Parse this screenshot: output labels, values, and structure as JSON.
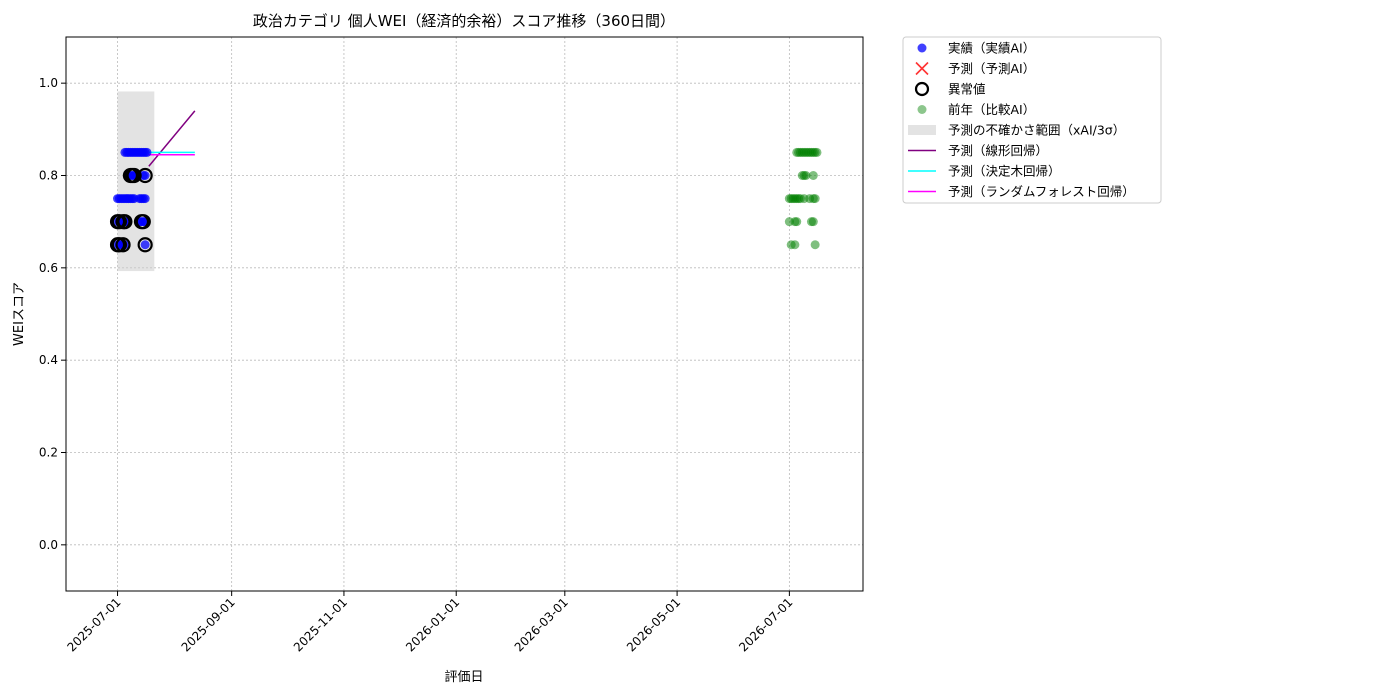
{
  "chart_data": {
    "type": "scatter",
    "title": "政治カテゴリ 個人WEI（経済的余裕）スコア推移（360日間）",
    "xlabel": "評価日",
    "ylabel": "WEIスコア",
    "xlim": [
      "2025-06-03",
      "2026-08-10"
    ],
    "ylim": [
      -0.1,
      1.1
    ],
    "x_ticks": [
      "2025-07-01",
      "2025-09-01",
      "2025-11-01",
      "2026-01-01",
      "2026-03-01",
      "2026-05-01",
      "2026-07-01"
    ],
    "y_ticks": [
      0.0,
      0.2,
      0.4,
      0.6,
      0.8,
      1.0
    ],
    "y_tick_labels": [
      "0.0",
      "0.2",
      "0.4",
      "0.6",
      "0.8",
      "1.0"
    ],
    "grid": true,
    "legend_position": "outside-right",
    "legend": [
      {
        "label": "実績（実績AI）",
        "marker": "dot",
        "color": "#0000ff"
      },
      {
        "label": "予測（予測AI）",
        "marker": "x",
        "color": "#ff0000"
      },
      {
        "label": "異常値",
        "marker": "ring",
        "color": "#000000"
      },
      {
        "label": "前年（比較AI）",
        "marker": "dot",
        "color": "#008000"
      },
      {
        "label": "予測の不確かさ範囲（xAI/3σ）",
        "marker": "patch",
        "color": "#cccccc"
      },
      {
        "label": "予測（線形回帰）",
        "marker": "line",
        "color": "#800080"
      },
      {
        "label": "予測（決定木回帰）",
        "marker": "line",
        "color": "#00ffff"
      },
      {
        "label": "予測（ランダムフォレスト回帰）",
        "marker": "line",
        "color": "#ff00ff"
      }
    ],
    "uncertainty_band": {
      "x": [
        "2025-07-01",
        "2025-07-21"
      ],
      "y": [
        0.593,
        0.982
      ]
    },
    "series": [
      {
        "name": "実績（実績AI）",
        "color": "#0000ff",
        "points": [
          [
            "2025-07-01",
            0.65
          ],
          [
            "2025-07-01",
            0.7
          ],
          [
            "2025-07-01",
            0.75
          ],
          [
            "2025-07-02",
            0.65
          ],
          [
            "2025-07-02",
            0.7
          ],
          [
            "2025-07-02",
            0.75
          ],
          [
            "2025-07-03",
            0.65
          ],
          [
            "2025-07-03",
            0.7
          ],
          [
            "2025-07-03",
            0.75
          ],
          [
            "2025-07-04",
            0.65
          ],
          [
            "2025-07-04",
            0.7
          ],
          [
            "2025-07-04",
            0.75
          ],
          [
            "2025-07-05",
            0.65
          ],
          [
            "2025-07-05",
            0.7
          ],
          [
            "2025-07-05",
            0.75
          ],
          [
            "2025-07-05",
            0.85
          ],
          [
            "2025-07-06",
            0.7
          ],
          [
            "2025-07-06",
            0.75
          ],
          [
            "2025-07-06",
            0.85
          ],
          [
            "2025-07-07",
            0.75
          ],
          [
            "2025-07-07",
            0.8
          ],
          [
            "2025-07-07",
            0.85
          ],
          [
            "2025-07-08",
            0.75
          ],
          [
            "2025-07-08",
            0.8
          ],
          [
            "2025-07-08",
            0.85
          ],
          [
            "2025-07-09",
            0.75
          ],
          [
            "2025-07-09",
            0.8
          ],
          [
            "2025-07-09",
            0.85
          ],
          [
            "2025-07-10",
            0.75
          ],
          [
            "2025-07-10",
            0.8
          ],
          [
            "2025-07-10",
            0.85
          ],
          [
            "2025-07-11",
            0.8
          ],
          [
            "2025-07-11",
            0.85
          ],
          [
            "2025-07-12",
            0.85
          ],
          [
            "2025-07-13",
            0.7
          ],
          [
            "2025-07-13",
            0.75
          ],
          [
            "2025-07-13",
            0.85
          ],
          [
            "2025-07-14",
            0.7
          ],
          [
            "2025-07-14",
            0.75
          ],
          [
            "2025-07-14",
            0.85
          ],
          [
            "2025-07-15",
            0.7
          ],
          [
            "2025-07-15",
            0.75
          ],
          [
            "2025-07-15",
            0.8
          ],
          [
            "2025-07-15",
            0.85
          ],
          [
            "2025-07-16",
            0.65
          ],
          [
            "2025-07-16",
            0.7
          ],
          [
            "2025-07-16",
            0.75
          ],
          [
            "2025-07-16",
            0.8
          ],
          [
            "2025-07-16",
            0.85
          ],
          [
            "2025-07-17",
            0.85
          ]
        ]
      },
      {
        "name": "異常値",
        "color": "#000000",
        "points": [
          [
            "2025-07-01",
            0.65
          ],
          [
            "2025-07-01",
            0.7
          ],
          [
            "2025-07-02",
            0.65
          ],
          [
            "2025-07-02",
            0.7
          ],
          [
            "2025-07-04",
            0.65
          ],
          [
            "2025-07-04",
            0.7
          ],
          [
            "2025-07-05",
            0.7
          ],
          [
            "2025-07-08",
            0.8
          ],
          [
            "2025-07-09",
            0.8
          ],
          [
            "2025-07-10",
            0.8
          ],
          [
            "2025-07-14",
            0.7
          ],
          [
            "2025-07-15",
            0.7
          ],
          [
            "2025-07-16",
            0.65
          ],
          [
            "2025-07-16",
            0.8
          ]
        ]
      },
      {
        "name": "前年（比較AI）",
        "color": "#008000",
        "points": [
          [
            "2026-07-01",
            0.7
          ],
          [
            "2026-07-01",
            0.75
          ],
          [
            "2026-07-02",
            0.65
          ],
          [
            "2026-07-02",
            0.75
          ],
          [
            "2026-07-03",
            0.75
          ],
          [
            "2026-07-04",
            0.65
          ],
          [
            "2026-07-04",
            0.7
          ],
          [
            "2026-07-04",
            0.75
          ],
          [
            "2026-07-05",
            0.7
          ],
          [
            "2026-07-05",
            0.75
          ],
          [
            "2026-07-05",
            0.85
          ],
          [
            "2026-07-06",
            0.75
          ],
          [
            "2026-07-06",
            0.85
          ],
          [
            "2026-07-07",
            0.75
          ],
          [
            "2026-07-07",
            0.85
          ],
          [
            "2026-07-08",
            0.8
          ],
          [
            "2026-07-08",
            0.85
          ],
          [
            "2026-07-09",
            0.75
          ],
          [
            "2026-07-09",
            0.8
          ],
          [
            "2026-07-09",
            0.85
          ],
          [
            "2026-07-10",
            0.8
          ],
          [
            "2026-07-10",
            0.85
          ],
          [
            "2026-07-11",
            0.85
          ],
          [
            "2026-07-12",
            0.75
          ],
          [
            "2026-07-12",
            0.85
          ],
          [
            "2026-07-13",
            0.7
          ],
          [
            "2026-07-13",
            0.85
          ],
          [
            "2026-07-14",
            0.7
          ],
          [
            "2026-07-14",
            0.75
          ],
          [
            "2026-07-14",
            0.8
          ],
          [
            "2026-07-14",
            0.85
          ],
          [
            "2026-07-15",
            0.65
          ],
          [
            "2026-07-15",
            0.75
          ],
          [
            "2026-07-15",
            0.85
          ],
          [
            "2026-07-16",
            0.85
          ]
        ]
      },
      {
        "name": "予測（線形回帰）",
        "color": "#800080",
        "line": [
          [
            "2025-07-18",
            0.82
          ],
          [
            "2025-08-12",
            0.94
          ]
        ]
      },
      {
        "name": "予測（決定木回帰）",
        "color": "#00ffff",
        "line": [
          [
            "2025-07-18",
            0.85
          ],
          [
            "2025-08-12",
            0.85
          ]
        ]
      },
      {
        "name": "予測（ランダムフォレスト回帰）",
        "color": "#ff00ff",
        "line": [
          [
            "2025-07-18",
            0.845
          ],
          [
            "2025-08-12",
            0.845
          ]
        ]
      }
    ]
  }
}
